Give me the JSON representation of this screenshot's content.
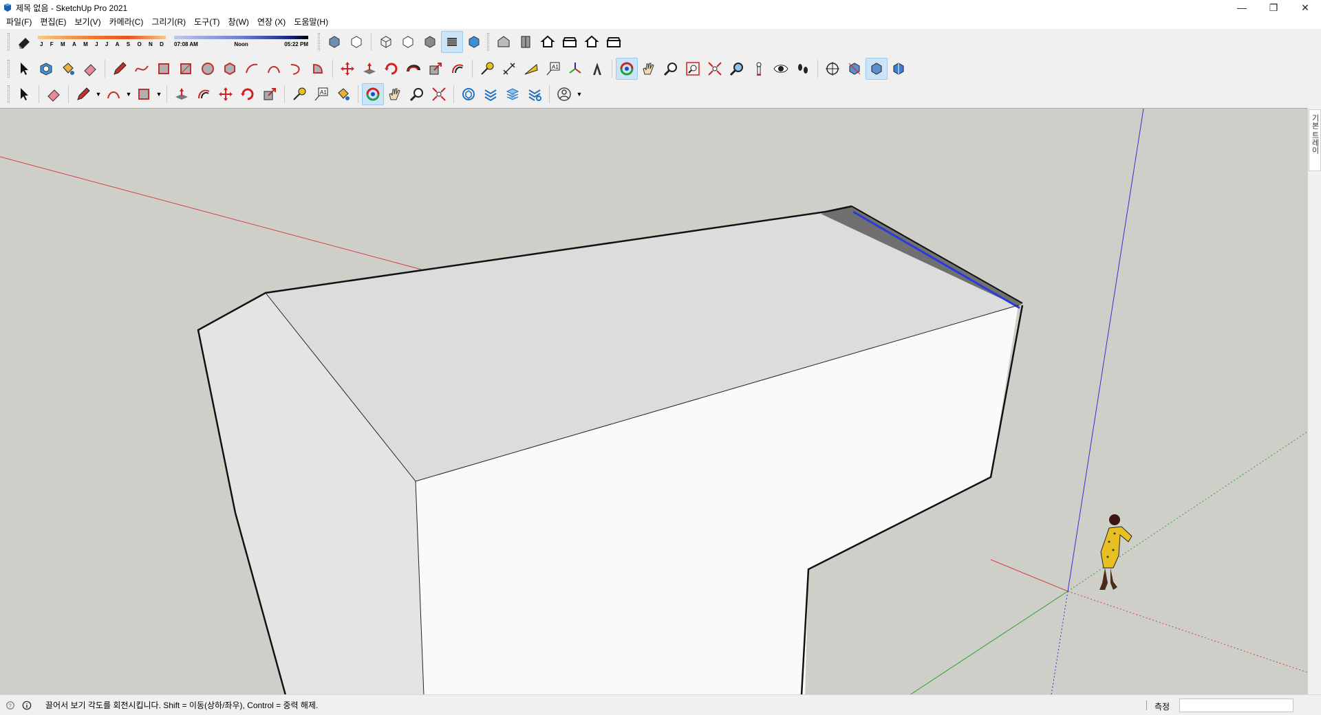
{
  "window": {
    "title": "제목 없음 - SketchUp Pro 2021",
    "minimize": "—",
    "restore": "❐",
    "close": "✕"
  },
  "menu": [
    {
      "id": "file",
      "label": "파일(F)"
    },
    {
      "id": "edit",
      "label": "편집(E)"
    },
    {
      "id": "view",
      "label": "보기(V)"
    },
    {
      "id": "camera",
      "label": "카메라(C)"
    },
    {
      "id": "draw",
      "label": "그리기(R)"
    },
    {
      "id": "tools",
      "label": "도구(T)"
    },
    {
      "id": "window",
      "label": "창(W)"
    },
    {
      "id": "extensions",
      "label": "연장 (X)"
    },
    {
      "id": "help",
      "label": "도움말(H)"
    }
  ],
  "shadows": {
    "months": [
      "J",
      "F",
      "M",
      "A",
      "M",
      "J",
      "J",
      "A",
      "S",
      "O",
      "N",
      "D"
    ],
    "time_start": "07:08 AM",
    "time_mid": "Noon",
    "time_end": "05:22 PM"
  },
  "tray": {
    "tab_label": "기본 트레이"
  },
  "status": {
    "message": "끌어서 보기 각도를 회전시킵니다. Shift = 이동(상하/좌우), Control = 중력 해제.",
    "measure_label": "측정",
    "measure_value": ""
  },
  "colors": {
    "viewport_bg": "#cfcfca",
    "axis_red": "#d04040",
    "axis_green": "#30a030",
    "axis_blue": "#3030d0",
    "face_top": "#dcdcdc",
    "face_front": "#fafafa",
    "face_side": "#e6e6e6",
    "active_tool": "#cce4f7"
  }
}
